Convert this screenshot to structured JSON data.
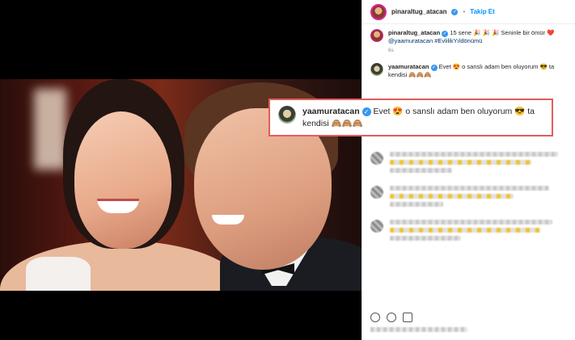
{
  "header": {
    "username": "pinaraltug_atacan",
    "separator": "•",
    "follow_label": "Takip Et"
  },
  "caption": {
    "username": "pinaraltug_atacan",
    "text": "15 sene 🎉 🎉 🎉 Seninle bir ömür ❤️",
    "mention": "@yaamuratacan",
    "hashtag": "#EvlilikYıldönümü",
    "time": "6s"
  },
  "reply": {
    "username": "yaamuratacan",
    "text": "Evet 😍 o sanslı adam ben oluyorum 😎 ta kendisi 🙈🙈🙈"
  },
  "callout": {
    "username": "yaamuratacan",
    "verified_mark": "✓",
    "text_line1": "Evet 😍 o sanslı adam ben oluyorum 😎 ta",
    "text_line2": "kendisi 🙈🙈🙈"
  },
  "colors": {
    "accent": "#0095f6",
    "highlight_border": "#e35c5c",
    "verified": "#3897f0"
  }
}
